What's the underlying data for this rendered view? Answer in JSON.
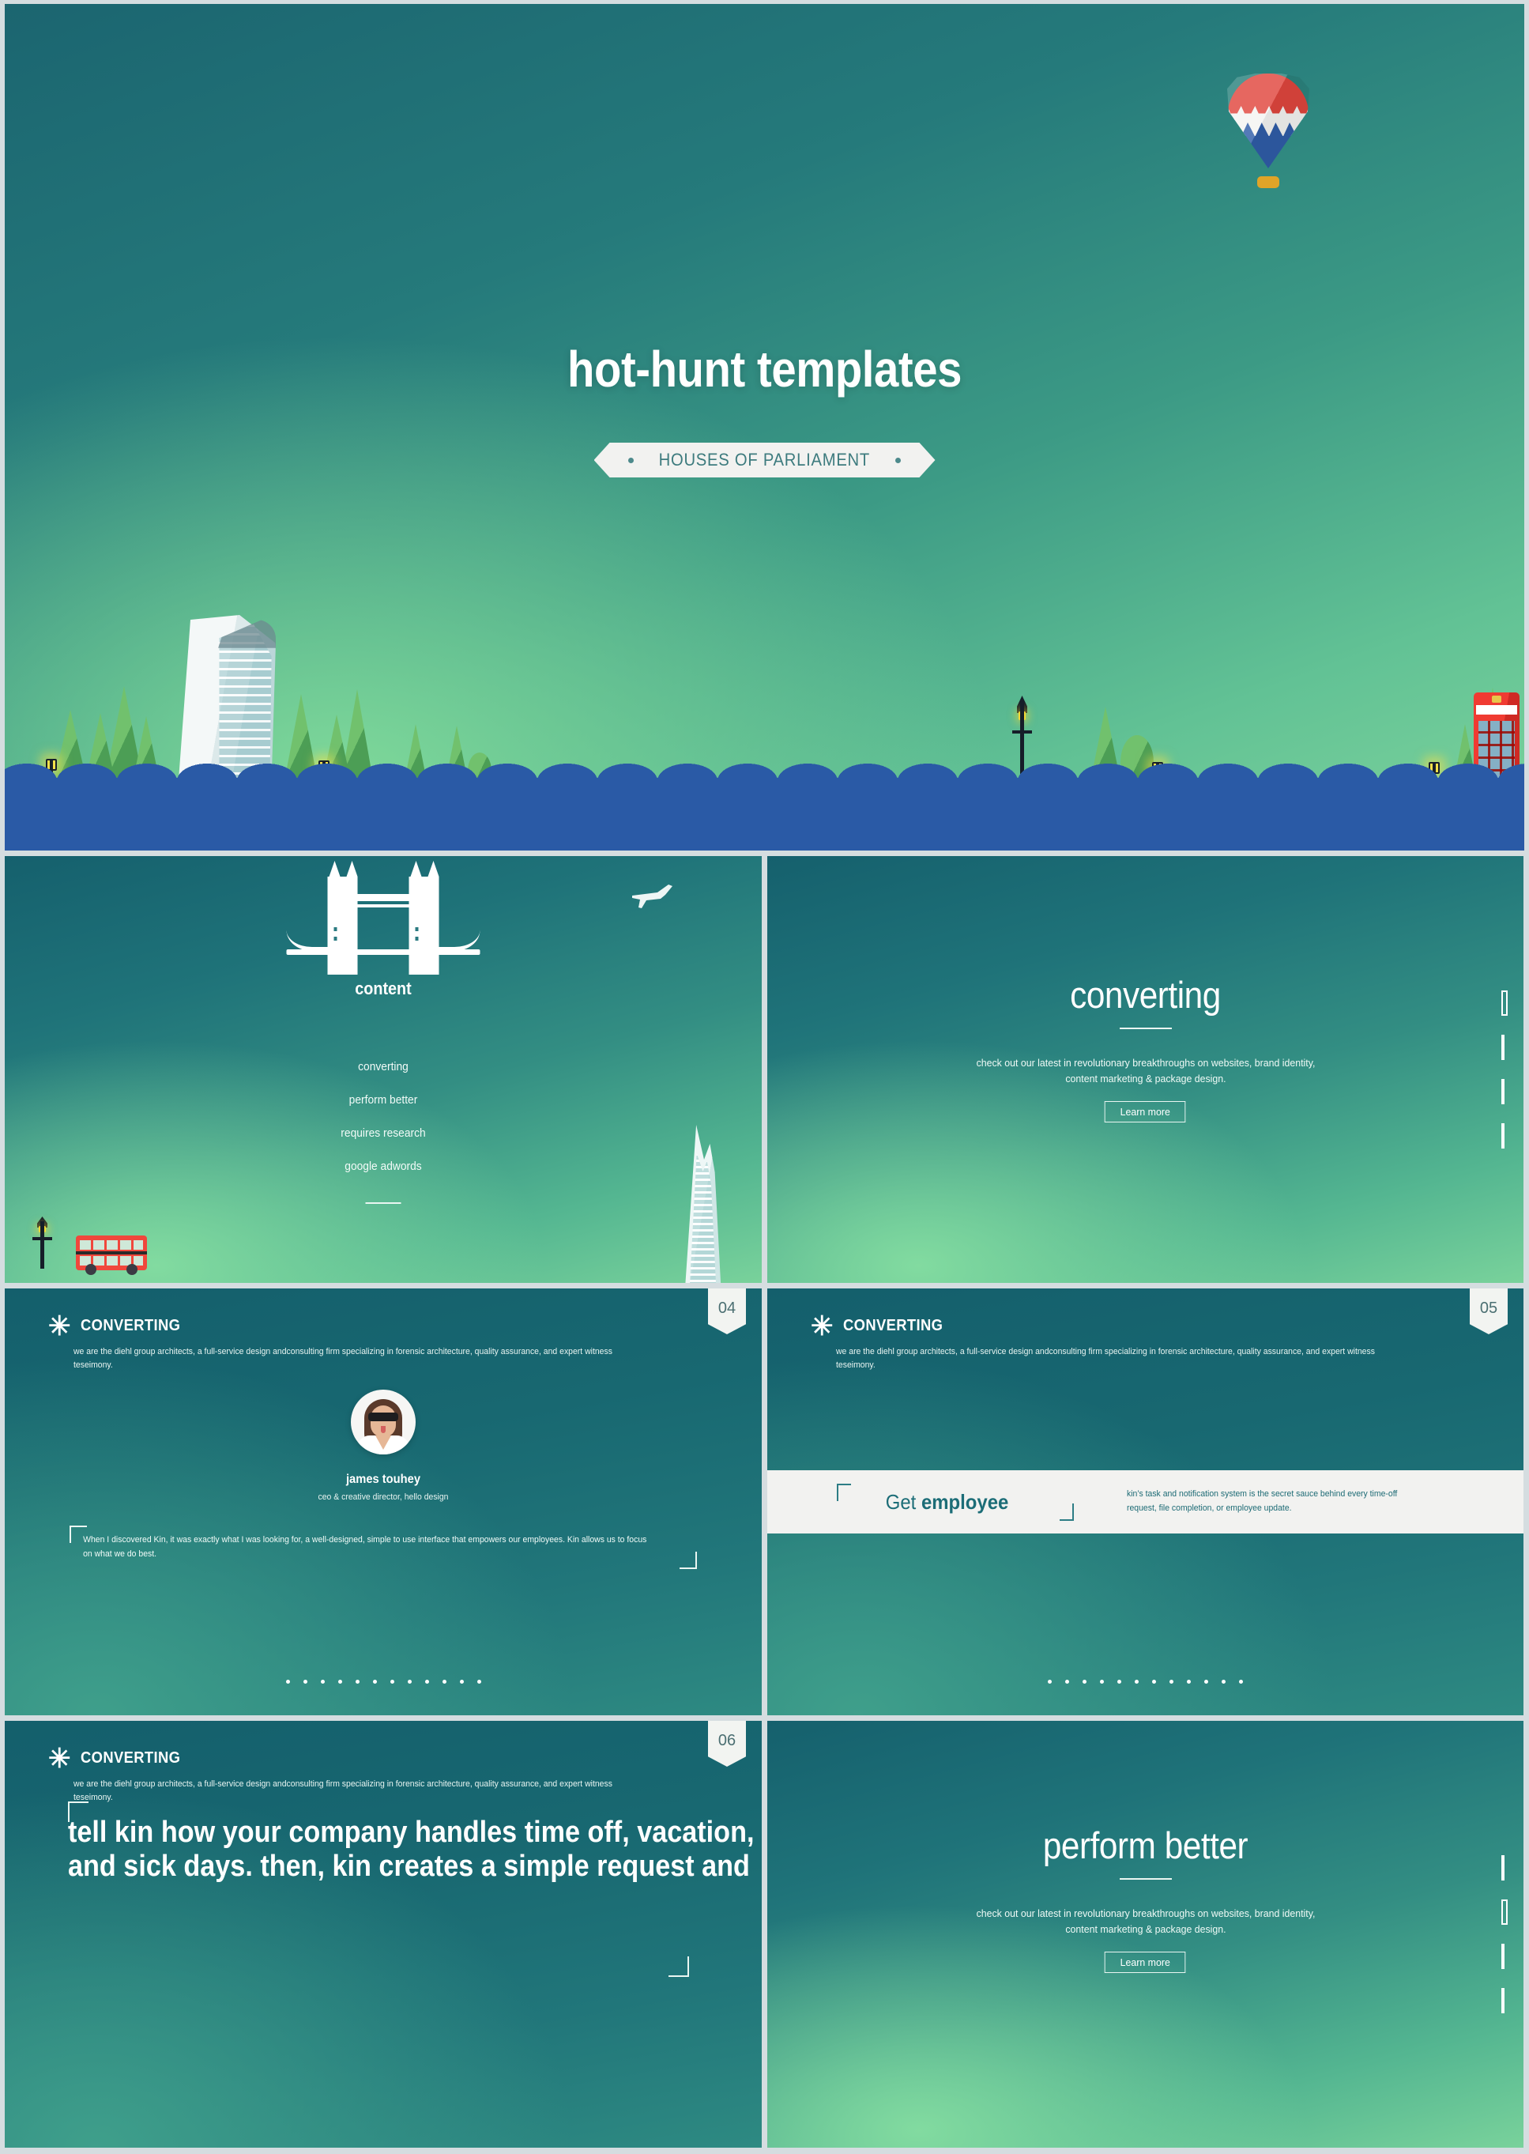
{
  "theme": {
    "accent_teal": "#1c6d77",
    "accent_green": "#7ed49c",
    "panel_light": "#f2f2f0",
    "gutter": "#d5dde0",
    "text_light": "#ffffff"
  },
  "hero": {
    "title": "hot-hunt templates",
    "ribbon_label": "HOUSES OF PARLIAMENT",
    "icons": [
      "hot-air-balloon-icon",
      "skyscraper-icon",
      "tree-icon",
      "street-lamp-icon",
      "phone-booth-icon"
    ]
  },
  "content_slide": {
    "heading": "content",
    "nav_items": [
      "converting",
      "perform better",
      "requires research",
      "google adwords"
    ],
    "icons": [
      "tower-bridge-icon",
      "airplane-icon",
      "double-decker-bus-icon",
      "shard-tower-icon",
      "street-lamp-icon"
    ]
  },
  "headline_slides": [
    {
      "title": "converting",
      "subtitle": "check out our latest in revolutionary breakthroughs on websites, brand identity, content marketing & package design.",
      "button_label": "Learn more",
      "ticks": 4,
      "active_tick": 1
    },
    {
      "title": "perform better",
      "subtitle": "check out our latest in revolutionary breakthroughs on websites, brand identity, content marketing & package design.",
      "button_label": "Learn more",
      "ticks": 4,
      "active_tick": 2
    }
  ],
  "section_header": {
    "asterisk": "✳",
    "kicker": "CONVERTING",
    "body": "we are the diehl group architects, a full-service design andconsulting firm specializing in forensic architecture, quality assurance, and expert witness teseimony."
  },
  "testimonial_slide": {
    "badge": "04",
    "name": "james touhey",
    "role": "ceo & creative director, hello design",
    "quote": "When I discovered Kin, it was exactly what I was looking for, a well-designed, simple to use interface that empowers our employees. Kin allows us to focus on what we do best.",
    "dot_count": 12
  },
  "employee_slide": {
    "badge": "05",
    "band_text_light": "Get ",
    "band_text_bold": "employee",
    "band_body": "kin’s task and notification system is the secret sauce behind every time-off request, file completion, or employee update.",
    "dot_count": 12
  },
  "statement_slide": {
    "badge": "06",
    "statement": "tell kin how your company handles time off, vacation, and sick days. then, kin creates a simple request and"
  }
}
